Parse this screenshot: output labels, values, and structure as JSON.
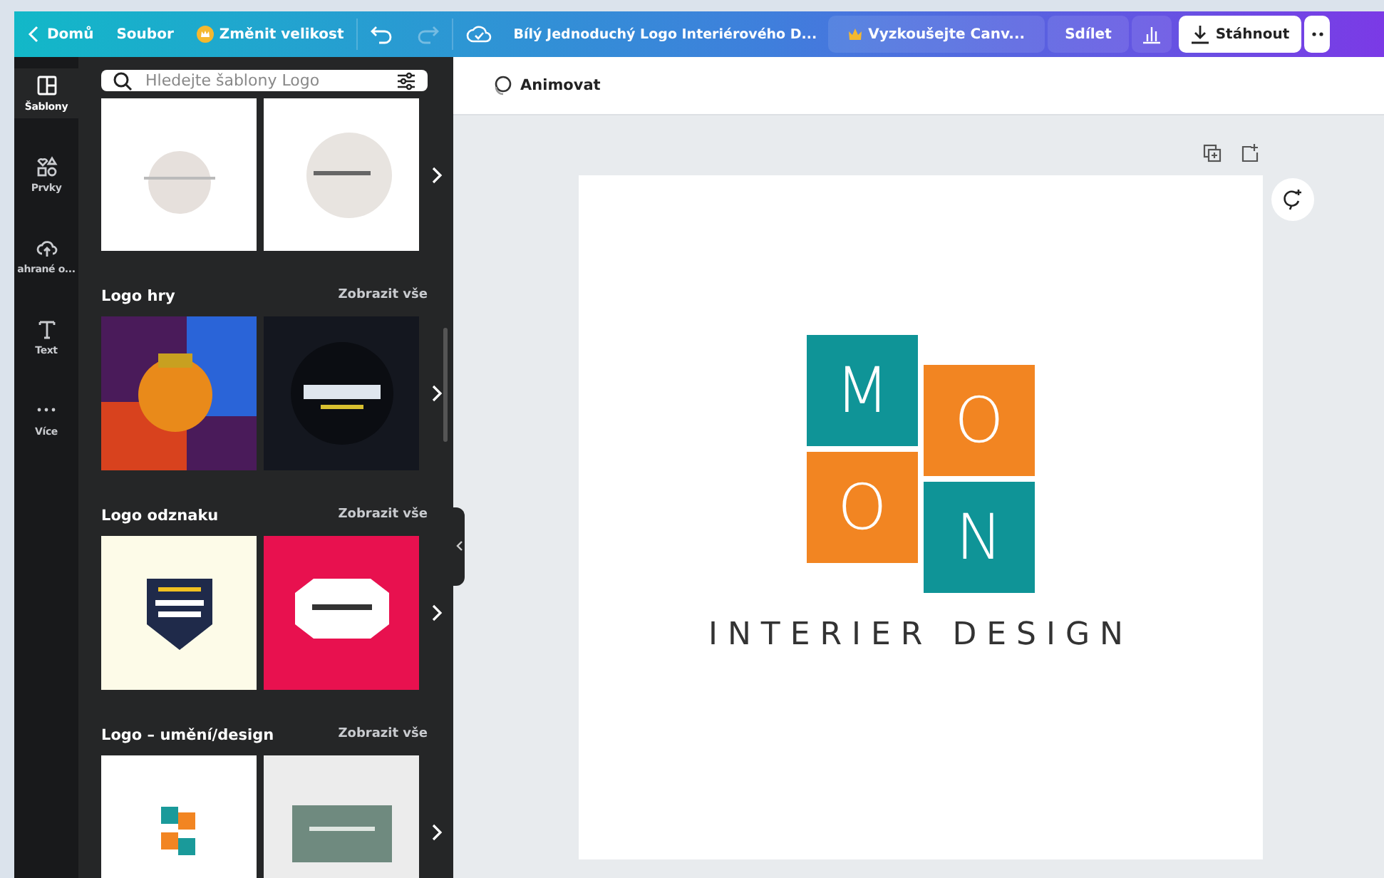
{
  "topbar": {
    "back": "Domů",
    "menu": "Soubor",
    "resize": "Změnit velikost",
    "undo": {
      "disabled": false
    },
    "redo": {
      "disabled": true
    },
    "title": "Bílý Jednoduchý Logo Interiérového D...",
    "trial": "Vyzkoušejte Canv...",
    "share": "Sdílet",
    "download": "Stáhnout"
  },
  "rail": [
    {
      "kind": "templates",
      "label": "Šablony",
      "selected": true
    },
    {
      "kind": "elements",
      "label": "Prvky",
      "selected": false
    },
    {
      "kind": "uploads",
      "label": "ahrané o...",
      "selected": false
    },
    {
      "kind": "text",
      "label": "Text",
      "selected": false
    },
    {
      "kind": "more",
      "label": "Více",
      "selected": false
    }
  ],
  "search": {
    "placeholder": "Hledejte šablony Logo"
  },
  "sections": [
    {
      "thumbs": [
        {
          "kind": "picture"
        },
        {
          "kind": "picture"
        }
      ]
    },
    {
      "title": "Logo hry",
      "link": "Zobrazit vše",
      "thumbs": [
        {
          "kind": "picture"
        },
        {
          "kind": "picture"
        }
      ]
    },
    {
      "title": "Logo odznaku",
      "link": "Zobrazit vše",
      "thumbs": [
        {
          "kind": "picture"
        },
        {
          "kind": "picture"
        }
      ]
    },
    {
      "title": "Logo – umění/design",
      "link": "Zobrazit vše",
      "thumbs": [
        {
          "kind": "picture"
        },
        {
          "kind": "picture"
        }
      ]
    }
  ],
  "toolbar": {
    "animate": "Animovat"
  },
  "design": {
    "tiles": [
      {
        "letter": "M",
        "color": "#0f9497"
      },
      {
        "letter": "O",
        "color": "#f28522"
      },
      {
        "letter": "O",
        "color": "#f28522"
      },
      {
        "letter": "N",
        "color": "#0f9497"
      }
    ],
    "caption": "INTERIER DESIGN"
  }
}
